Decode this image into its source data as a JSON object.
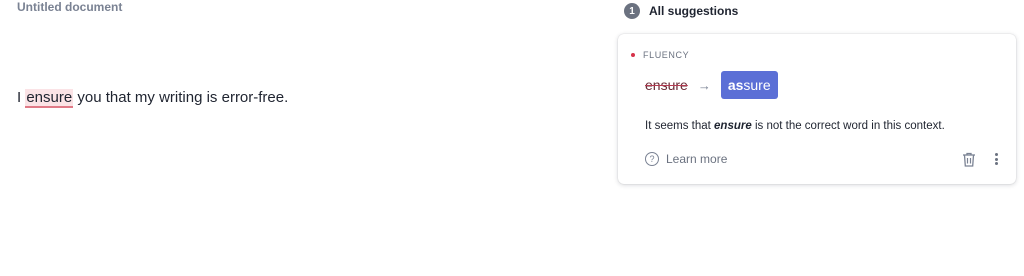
{
  "document": {
    "title": "Untitled document",
    "text_before": "I ",
    "flagged_word": "ensure",
    "text_after": " you that my writing is error-free."
  },
  "suggestions_panel": {
    "count": "1",
    "title": "All suggestions"
  },
  "suggestion_card": {
    "category": "FLUENCY",
    "category_color": "#d6334a",
    "original": "ensure",
    "arrow_icon": "arrow-right-icon",
    "replacement_bold": "as",
    "replacement_rest": "sure",
    "replacement_color": "#5b6fd6",
    "explanation_before": "It seems that ",
    "explanation_keyword": "ensure",
    "explanation_after": " is not the correct word in this context.",
    "learn_more": "Learn more",
    "dismiss_icon": "trash-icon",
    "more_icon": "more-vertical-icon"
  }
}
